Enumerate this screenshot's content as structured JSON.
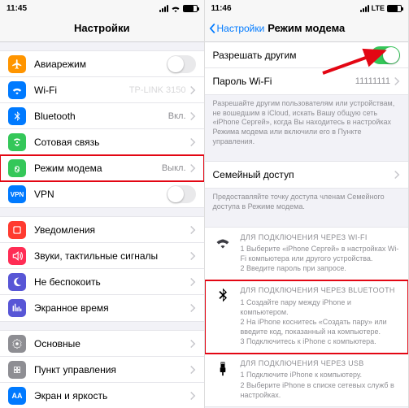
{
  "left": {
    "status_time": "11:45",
    "title": "Настройки",
    "rows": {
      "airplane": {
        "label": "Авиарежим"
      },
      "wifi": {
        "label": "Wi-Fi",
        "value": "TP-LINK 3150"
      },
      "bluetooth": {
        "label": "Bluetooth",
        "value": "Вкл."
      },
      "cellular": {
        "label": "Сотовая связь"
      },
      "hotspot": {
        "label": "Режим модема",
        "value": "Выкл."
      },
      "vpn": {
        "label": "VPN"
      },
      "notif": {
        "label": "Уведомления"
      },
      "sounds": {
        "label": "Звуки, тактильные сигналы"
      },
      "dnd": {
        "label": "Не беспокоить"
      },
      "screentime": {
        "label": "Экранное время"
      },
      "general": {
        "label": "Основные"
      },
      "control": {
        "label": "Пункт управления"
      },
      "display": {
        "label": "Экран и яркость"
      }
    }
  },
  "right": {
    "status_time": "11:46",
    "status_net": "LTE",
    "back": "Настройки",
    "title": "Режим модема",
    "allow_label": "Разрешать другим",
    "pwd_label": "Пароль Wi-Fi",
    "pwd_value": "11111111",
    "note1": "Разрешайте другим пользователям или устройствам, не вошедшим в iCloud, искать Вашу общую сеть «iPhone Сергей», когда Вы находитесь в настройках Режима модема или включили его в Пункте управления.",
    "family_label": "Семейный доступ",
    "note2": "Предоставляйте точку доступа членам Семейного доступа в Режиме модема.",
    "wifi": {
      "cap": "ДЛЯ ПОДКЛЮЧЕНИЯ ЧЕРЕЗ WI-FI",
      "l1": "1 Выберите «iPhone Сергей» в настройках Wi-Fi компьютера или другого устройства.",
      "l2": "2 Введите пароль при запросе."
    },
    "bt": {
      "cap": "ДЛЯ ПОДКЛЮЧЕНИЯ ЧЕРЕЗ BLUETOOTH",
      "l1": "1 Создайте пару между iPhone и компьютером.",
      "l2": "2 На iPhone коснитесь «Создать пару» или введите код, показанный на компьютере.",
      "l3": "3 Подключитесь к iPhone с компьютера."
    },
    "usb": {
      "cap": "ДЛЯ ПОДКЛЮЧЕНИЯ ЧЕРЕЗ USB",
      "l1": "1 Подключите iPhone к компьютеру.",
      "l2": "2 Выберите iPhone в списке сетевых служб в настройках."
    }
  }
}
